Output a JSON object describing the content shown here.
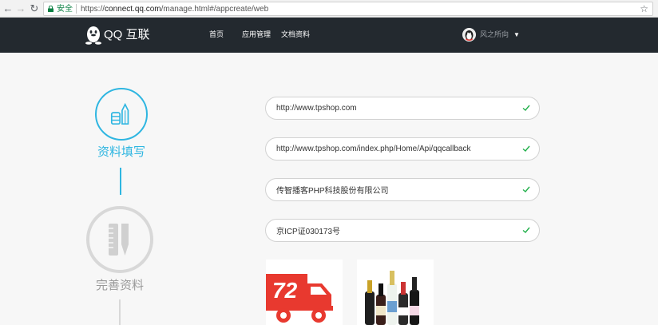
{
  "browser": {
    "secure_label": "安全",
    "url_scheme": "https://",
    "url_host": "connect.qq.com",
    "url_path": "/manage.html#/appcreate/web"
  },
  "header": {
    "brand": "QQ 互联",
    "nav": [
      "首页",
      "应用管理",
      "文档资料"
    ],
    "username": "风之所向"
  },
  "steps": [
    {
      "label": "资料填写",
      "state": "active"
    },
    {
      "label": "完善资料",
      "state": "inactive"
    }
  ],
  "form": {
    "fields": [
      {
        "value": "http://www.tpshop.com",
        "valid": true
      },
      {
        "value": "http://www.tpshop.com/index.php/Home/Api/qqcallback",
        "valid": true
      },
      {
        "value": "传智播客PHP科技股份有限公司",
        "valid": true
      },
      {
        "value": "京ICP证030173号",
        "valid": true
      }
    ]
  },
  "images": {
    "truck_badge": "72"
  },
  "colors": {
    "accent": "#2fb6e1",
    "header_bg": "#23292f",
    "check": "#22b04b",
    "truck_red": "#e8392f",
    "inactive": "#d8d8d8"
  }
}
